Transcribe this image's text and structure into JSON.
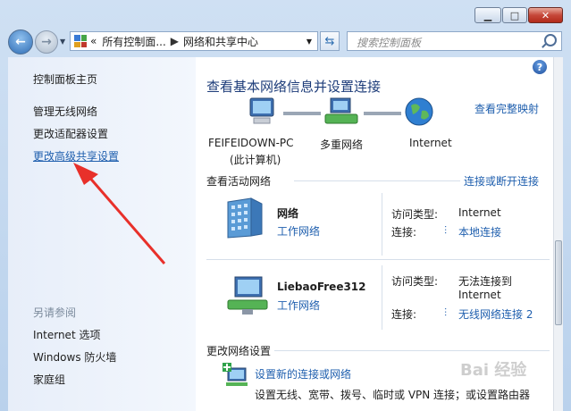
{
  "window": {
    "minimize_icon": "minimize-icon",
    "maximize_icon": "maximize-icon",
    "close_icon": "close-icon"
  },
  "nav": {
    "breadcrumb": [
      "«",
      "所有控制面...",
      "网络和共享中心"
    ],
    "search_placeholder": "搜索控制面板"
  },
  "sidebar": {
    "items": [
      {
        "label": "控制面板主页"
      },
      {
        "label": "管理无线网络"
      },
      {
        "label": "更改适配器设置"
      },
      {
        "label": "更改高级共享设置"
      }
    ],
    "see_also_title": "另请参阅",
    "see_also": [
      {
        "label": "Internet 选项"
      },
      {
        "label": "Windows 防火墙"
      },
      {
        "label": "家庭组"
      }
    ]
  },
  "main": {
    "title": "查看基本网络信息并设置连接",
    "view_full_map": "查看完整映射",
    "map_nodes": {
      "computer_name": "FEIFEIDOWN-PC",
      "computer_sub": "(此计算机)",
      "middle": "多重网络",
      "internet": "Internet"
    },
    "active_title": "查看活动网络",
    "connect_disconnect": "连接或断开连接",
    "networks": [
      {
        "name": "网络",
        "type_link": "工作网络",
        "access_label": "访问类型:",
        "access_value": "Internet",
        "conn_label": "连接:",
        "conn_value": "本地连接"
      },
      {
        "name": "LiebaoFree312",
        "type_link": "工作网络",
        "access_label": "访问类型:",
        "access_value": "无法连接到",
        "access_value2": "Internet",
        "conn_label": "连接:",
        "conn_value": "无线网络连接 2"
      }
    ],
    "change_title": "更改网络设置",
    "setup_link": "设置新的连接或网络",
    "setup_desc": "设置无线、宽带、拨号、临时或 VPN 连接；或设置路由器"
  },
  "watermark": "Bai 经验",
  "colors": {
    "link": "#1f5fae",
    "title": "#1e3d7a",
    "arrow": "#e8302a"
  }
}
